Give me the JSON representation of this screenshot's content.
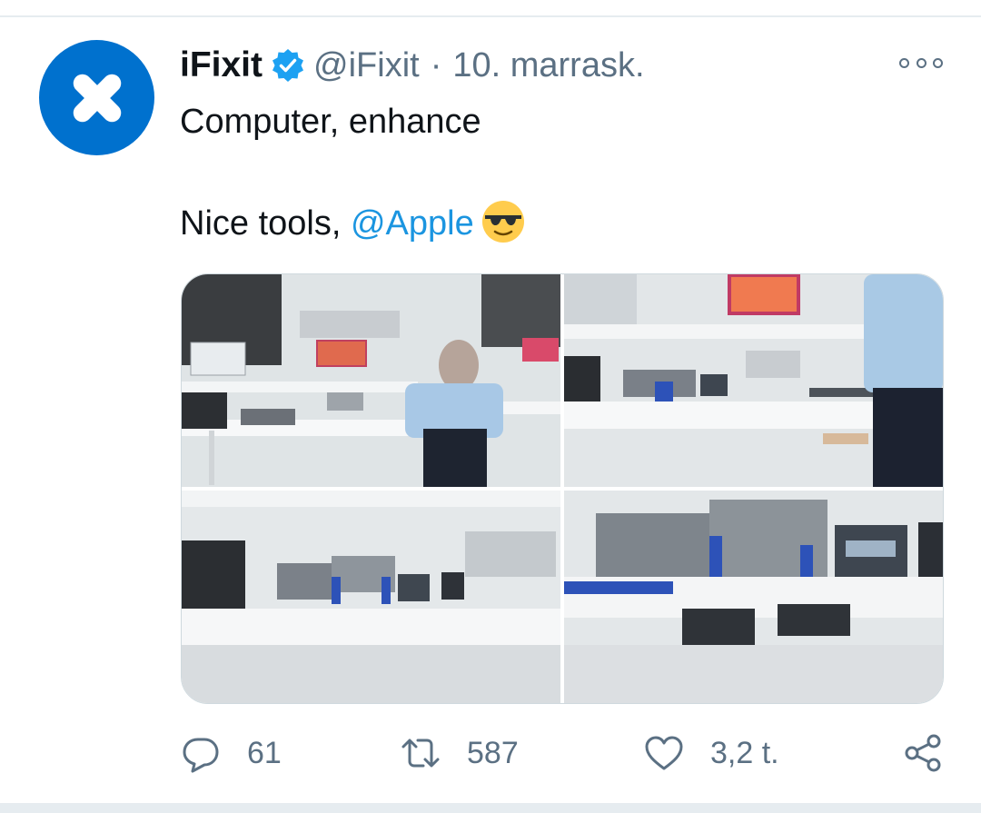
{
  "tweet": {
    "author": {
      "display_name": "iFixit",
      "handle": "@iFixit",
      "verified": true,
      "avatar_color": "#0071ce"
    },
    "separator": "·",
    "date": "10. marrask.",
    "text_line1": "Computer, enhance",
    "text_line2_prefix": "Nice tools, ",
    "mention": "@Apple",
    "emoji": "smiling-face-with-sunglasses"
  },
  "media": {
    "count": 4,
    "images": [
      {
        "name": "photo-lab-wide"
      },
      {
        "name": "photo-lab-zoom-1"
      },
      {
        "name": "photo-lab-zoom-2"
      },
      {
        "name": "photo-lab-zoom-3"
      }
    ]
  },
  "actions": {
    "reply_count": "61",
    "retweet_count": "587",
    "like_count": "3,2 t."
  },
  "colors": {
    "link": "#1b95e0",
    "muted": "#5b7083",
    "verified_badge": "#1da1f2",
    "text": "#0f1419"
  }
}
